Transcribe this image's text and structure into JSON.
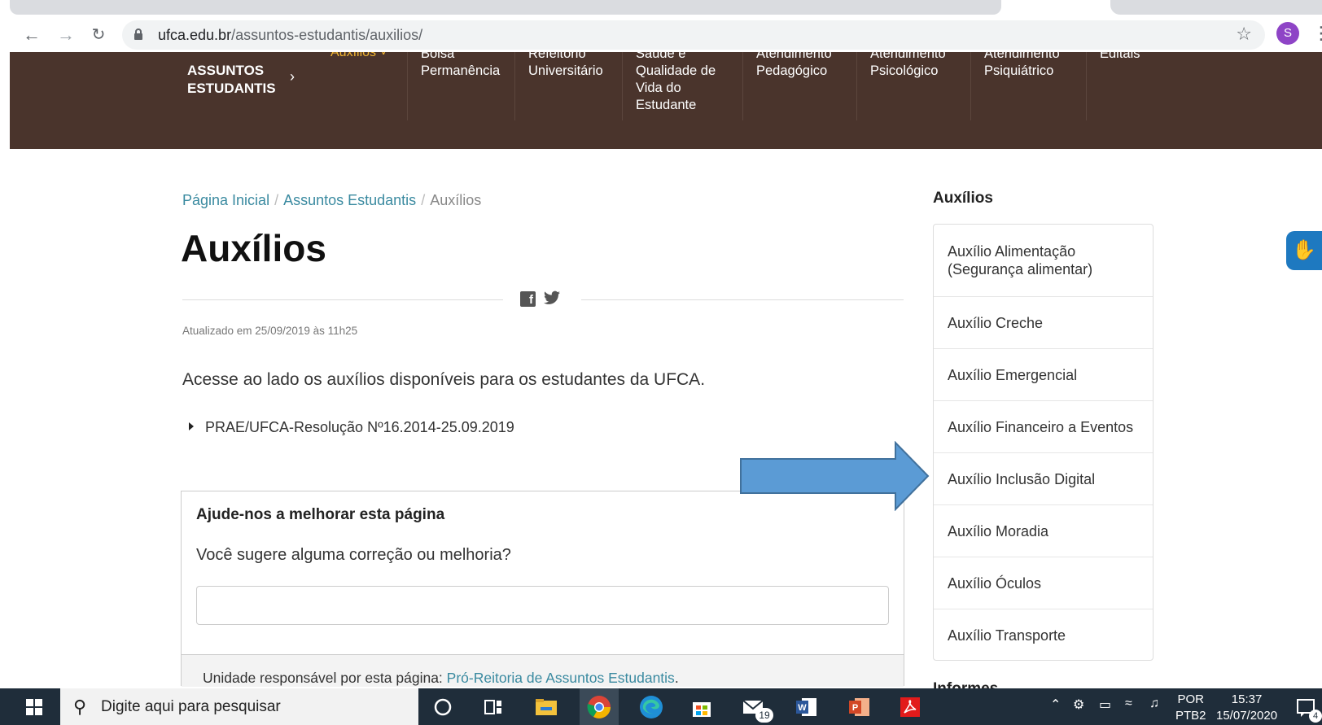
{
  "browser": {
    "url_domain": "ufca.edu.br",
    "url_path": "/assuntos-estudantis/auxilios/",
    "profile_initial": "S"
  },
  "site_nav": {
    "brand_line1": "ASSUNTOS",
    "brand_line2": "ESTUDANTIS",
    "active_item": "Auxílios",
    "items": [
      {
        "label": "Bolsa Permanência"
      },
      {
        "label": "Refeitório Universitário"
      },
      {
        "label": "Saúde e Qualidade de Vida do Estudante"
      },
      {
        "label": "Atendimento Pedagógico"
      },
      {
        "label": "Atendimento Psicológico"
      },
      {
        "label": "Atendimento Psiquiátrico"
      },
      {
        "label": "Editais"
      }
    ]
  },
  "breadcrumb": {
    "home": "Página Inicial",
    "section": "Assuntos Estudantis",
    "current": "Auxílios",
    "separator": "/"
  },
  "page": {
    "title": "Auxílios",
    "updated": "Atualizado em 25/09/2019 às 11h25",
    "intro": "Acesse ao lado os auxílios disponíveis para os estudantes da UFCA.",
    "resolution_link": "PRAE/UFCA-Resolução Nº16.2014-25.09.2019"
  },
  "feedback": {
    "title": "Ajude-nos a melhorar esta página",
    "question": "Você sugere alguma correção ou melhoria?",
    "unit_label": "Unidade responsável por esta página: ",
    "unit_link": "Pró-Reitoria de Assuntos Estudantis",
    "unit_end": "."
  },
  "sidebar": {
    "title": "Auxílios",
    "items": [
      {
        "label": "Auxílio Alimentação (Segurança alimentar)"
      },
      {
        "label": "Auxílio Creche"
      },
      {
        "label": "Auxílio Emergencial"
      },
      {
        "label": "Auxílio Financeiro a Eventos"
      },
      {
        "label": "Auxílio Inclusão Digital"
      },
      {
        "label": "Auxílio Moradia"
      },
      {
        "label": "Auxílio Óculos"
      },
      {
        "label": "Auxílio Transporte"
      }
    ],
    "next_section": "Informes"
  },
  "taskbar": {
    "search_placeholder": "Digite aqui para pesquisar",
    "mail_badge": "19",
    "lang_line1": "POR",
    "lang_line2": "PTB2",
    "time": "15:37",
    "date": "15/07/2020",
    "notification_count": "4"
  },
  "colors": {
    "header_bg": "#4a342c",
    "active_nav": "#f2b632",
    "link": "#3a8aa0",
    "arrow": "#5b9bd5"
  }
}
